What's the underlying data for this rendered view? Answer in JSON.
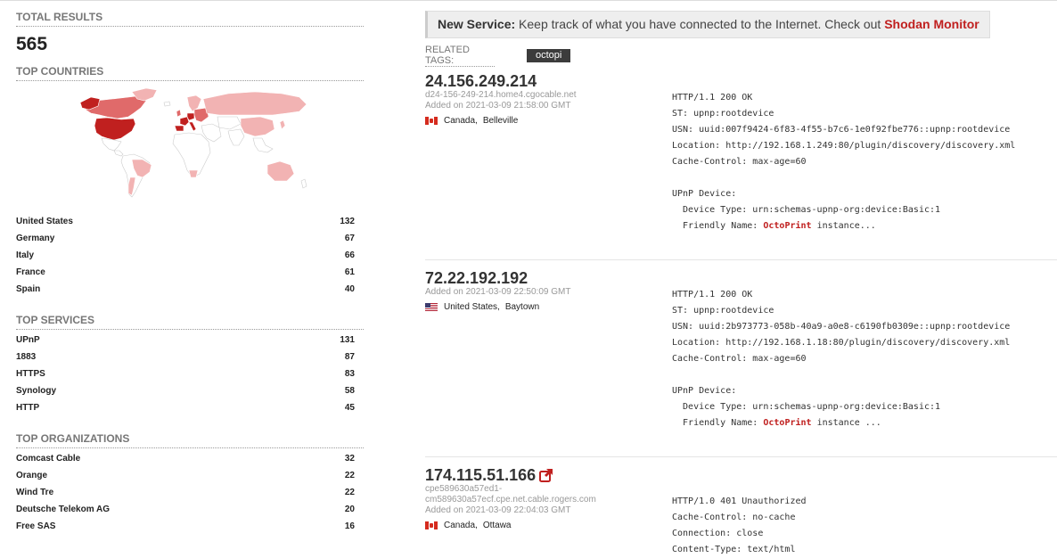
{
  "sidebar": {
    "total_title": "Total Results",
    "total_value": "565",
    "countries_title": "Top Countries",
    "countries": [
      {
        "name": "United States",
        "count": "132"
      },
      {
        "name": "Germany",
        "count": "67"
      },
      {
        "name": "Italy",
        "count": "66"
      },
      {
        "name": "France",
        "count": "61"
      },
      {
        "name": "Spain",
        "count": "40"
      }
    ],
    "services_title": "Top Services",
    "services": [
      {
        "name": "UPnP",
        "count": "131"
      },
      {
        "name": "1883",
        "count": "87"
      },
      {
        "name": "HTTPS",
        "count": "83"
      },
      {
        "name": "Synology",
        "count": "58"
      },
      {
        "name": "HTTP",
        "count": "45"
      }
    ],
    "orgs_title": "Top Organizations",
    "orgs": [
      {
        "name": "Comcast Cable",
        "count": "32"
      },
      {
        "name": "Orange",
        "count": "22"
      },
      {
        "name": "Wind Tre",
        "count": "22"
      },
      {
        "name": "Deutsche Telekom AG",
        "count": "20"
      },
      {
        "name": "Free SAS",
        "count": "16"
      }
    ]
  },
  "banner": {
    "strong": "New Service:",
    "text": " Keep track of what you have connected to the Internet. Check out ",
    "link": "Shodan Monitor"
  },
  "related_tags": {
    "label": "Related Tags:",
    "tags": [
      "octopi"
    ]
  },
  "results": [
    {
      "ip": "24.156.249.214",
      "hostname_lines": [
        "d24-156-249-214.home4.cgocable.net"
      ],
      "added": "Added on 2021-03-09 21:58:00 GMT",
      "country": "Canada",
      "city": "Belleville",
      "flag": "canada-flag-icon",
      "banner_before": "HTTP/1.1 200 OK\nST: upnp:rootdevice\nUSN: uuid:007f9424-6f83-4f55-b7c6-1e0f92fbe776::upnp:rootdevice\nLocation: http://192.168.1.249:80/plugin/discovery/discovery.xml\nCache-Control: max-age=60\n\nUPnP Device:\n  Device Type: urn:schemas-upnp-org:device:Basic:1\n  Friendly Name: ",
      "banner_highlight": "OctoPrint",
      "banner_after": " instance..."
    },
    {
      "ip": "72.22.192.192",
      "hostname_lines": [],
      "added": "Added on 2021-03-09 22:50:09 GMT",
      "country": "United States",
      "city": "Baytown",
      "flag": "us-flag-icon",
      "banner_before": "HTTP/1.1 200 OK\nST: upnp:rootdevice\nUSN: uuid:2b973773-058b-40a9-a0e8-c6190fb0309e::upnp:rootdevice\nLocation: http://192.168.1.18:80/plugin/discovery/discovery.xml\nCache-Control: max-age=60\n\nUPnP Device:\n  Device Type: urn:schemas-upnp-org:device:Basic:1\n  Friendly Name: ",
      "banner_highlight": "OctoPrint",
      "banner_after": " instance ..."
    },
    {
      "ip": "174.115.51.166",
      "hostname_lines": [
        "cpe589630a57ed1-",
        "cm589630a57ecf.cpe.net.cable.rogers.com"
      ],
      "added": "Added on 2021-03-09 22:04:03 GMT",
      "country": "Canada",
      "city": "Ottawa",
      "flag": "canada-flag-icon",
      "external_link_icon": "external-link-icon",
      "banner_before": "HTTP/1.0 401 Unauthorized\nCache-Control: no-cache\nConnection: close\nContent-Type: text/html",
      "banner_highlight": "",
      "banner_after": ""
    }
  ],
  "colors": {
    "accent": "#c0201f",
    "map_dark": "#c0201f",
    "map_mid": "#e06a6a",
    "map_light": "#f2b3b3",
    "map_none": "#ffffff"
  }
}
